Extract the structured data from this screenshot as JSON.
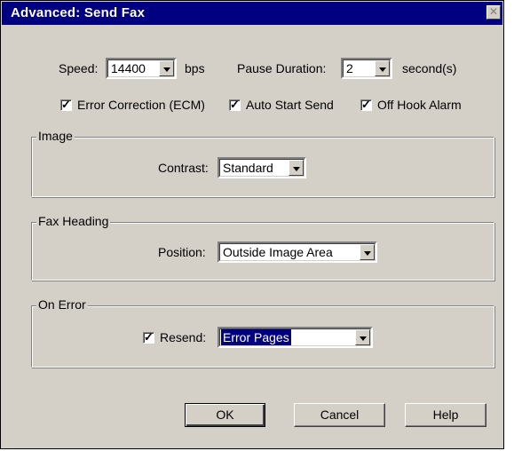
{
  "window": {
    "title": "Advanced: Send Fax",
    "close_glyph": "✕"
  },
  "settings": {
    "speed_label": "Speed:",
    "speed_value": "14400",
    "speed_unit": "bps",
    "pause_label": "Pause Duration:",
    "pause_value": "2",
    "pause_unit": "second(s)",
    "checkboxes": [
      {
        "label": "Error Correction (ECM)",
        "checked": true
      },
      {
        "label": "Auto Start Send",
        "checked": true
      },
      {
        "label": "Off Hook Alarm",
        "checked": true
      }
    ]
  },
  "image_group": {
    "title": "Image",
    "contrast_label": "Contrast:",
    "contrast_value": "Standard"
  },
  "heading_group": {
    "title": "Fax Heading",
    "position_label": "Position:",
    "position_value": "Outside Image Area"
  },
  "error_group": {
    "title": "On Error",
    "resend_label": "Resend:",
    "resend_checked": true,
    "resend_value": "Error Pages"
  },
  "buttons": {
    "ok": "OK",
    "cancel": "Cancel",
    "help": "Help"
  },
  "check_glyph": "✓"
}
